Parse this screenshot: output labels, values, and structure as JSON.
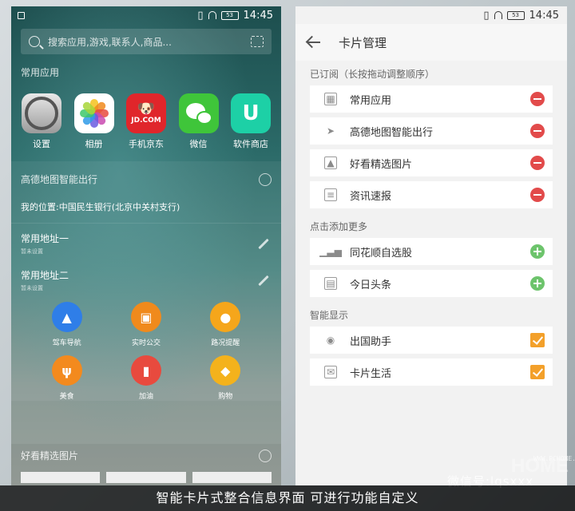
{
  "status": {
    "time": "14:45",
    "battery": "53"
  },
  "left": {
    "search_placeholder": "搜索应用,游戏,联系人,商品...",
    "frequent_apps_title": "常用应用",
    "apps": [
      {
        "label": "设置",
        "icon": "settings-icon"
      },
      {
        "label": "相册",
        "icon": "photos-icon"
      },
      {
        "label": "手机京东",
        "icon": "jd-icon",
        "icon_text": "JD.COM"
      },
      {
        "label": "微信",
        "icon": "wechat-icon"
      },
      {
        "label": "软件商店",
        "icon": "app-store-icon"
      }
    ],
    "map_card_title": "高德地图智能出行",
    "location": "我的位置:中国民生银行(北京中关村支行)",
    "addresses": [
      {
        "title": "常用地址一",
        "sub": "暂未设置"
      },
      {
        "title": "常用地址二",
        "sub": "暂未设置"
      }
    ],
    "shortcuts": [
      {
        "label": "驾车导航",
        "color": "#2f7ee8",
        "icon": "navigation-arrow-icon"
      },
      {
        "label": "实时公交",
        "color": "#f08a1c",
        "icon": "bus-icon"
      },
      {
        "label": "路况提醒",
        "color": "#f5a61b",
        "icon": "traffic-light-icon"
      },
      {
        "label": "美食",
        "color": "#f38a1e",
        "icon": "fork-knife-icon"
      },
      {
        "label": "加油",
        "color": "#e84a3e",
        "icon": "fuel-icon"
      },
      {
        "label": "购物",
        "color": "#f4b21c",
        "icon": "shopping-tag-icon"
      }
    ],
    "pictures_card_title": "好看精选图片"
  },
  "right": {
    "title": "卡片管理",
    "subscribed_header": "已订阅（长按拖动调整顺序）",
    "subscribed": [
      {
        "label": "常用应用",
        "icon": "grid-icon"
      },
      {
        "label": "高德地图智能出行",
        "icon": "paper-plane-icon"
      },
      {
        "label": "好看精选图片",
        "icon": "image-icon"
      },
      {
        "label": "资讯速报",
        "icon": "news-list-icon"
      }
    ],
    "more_header": "点击添加更多",
    "more": [
      {
        "label": "同花顺自选股",
        "icon": "stock-chart-icon"
      },
      {
        "label": "今日头条",
        "icon": "toutiao-icon"
      }
    ],
    "smart_header": "智能显示",
    "smart": [
      {
        "label": "出国助手",
        "icon": "globe-icon"
      },
      {
        "label": "卡片生活",
        "icon": "ticket-icon"
      }
    ]
  },
  "caption": "智能卡片式整合信息界面 可进行功能自定义",
  "watermark": "微信号:lqsxxx",
  "watermark_site": "WWW.PCHOME.NET"
}
